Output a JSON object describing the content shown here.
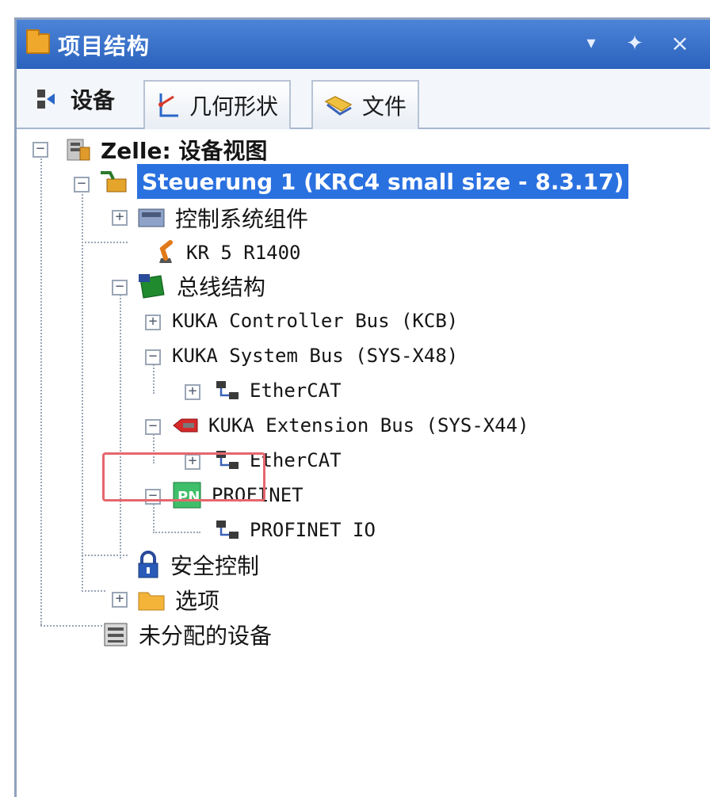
{
  "window": {
    "title": "项目结构",
    "buttons": {
      "dropdown": "▾",
      "pin": "✦",
      "close": "×"
    }
  },
  "tabs": [
    {
      "label": "设备",
      "icon": "devices-icon",
      "active": true
    },
    {
      "label": "几何形状",
      "icon": "geometry-icon",
      "active": false
    },
    {
      "label": "文件",
      "icon": "files-icon",
      "active": false
    }
  ],
  "tree": {
    "root": {
      "label": "Zelle: 设备视图",
      "icon": "cell-icon",
      "expander": "−"
    },
    "controller": {
      "label": "Steuerung 1 (KRC4 small size - 8.3.17)",
      "icon": "controller-icon",
      "expander": "−",
      "selected": true
    },
    "control_components": {
      "label": "控制系统组件",
      "icon": "component-icon",
      "expander": "+"
    },
    "robot": {
      "label": "KR 5 R1400",
      "icon": "robot-arm-icon"
    },
    "bus_structure": {
      "label": "总线结构",
      "icon": "bus-structure-icon",
      "expander": "−"
    },
    "kcb": {
      "label": "KUKA Controller Bus (KCB)",
      "expander": "+"
    },
    "sys_bus": {
      "label": "KUKA System Bus (SYS-X48)",
      "expander": "−"
    },
    "ethercat_1": {
      "label": "EtherCAT",
      "icon": "network-icon",
      "expander": "+"
    },
    "ext_bus": {
      "label": "KUKA Extension Bus (SYS-X44)",
      "icon": "extension-bus-icon",
      "expander": "−"
    },
    "ethercat_2": {
      "label": "EtherCAT",
      "icon": "network-icon",
      "expander": "+"
    },
    "profinet": {
      "label": "PROFINET",
      "icon": "profinet-icon",
      "expander": "−"
    },
    "profinet_io": {
      "label": "PROFINET IO",
      "icon": "network-icon"
    },
    "safety": {
      "label": "安全控制",
      "icon": "safety-lock-icon"
    },
    "options": {
      "label": "选项",
      "icon": "folder-icon",
      "expander": "+"
    },
    "unassigned": {
      "label": "未分配的设备",
      "icon": "unassigned-device-icon"
    }
  },
  "colors": {
    "title_bar": "#2b62bd",
    "selection": "#2a71e0",
    "highlight": "#e6666e"
  }
}
